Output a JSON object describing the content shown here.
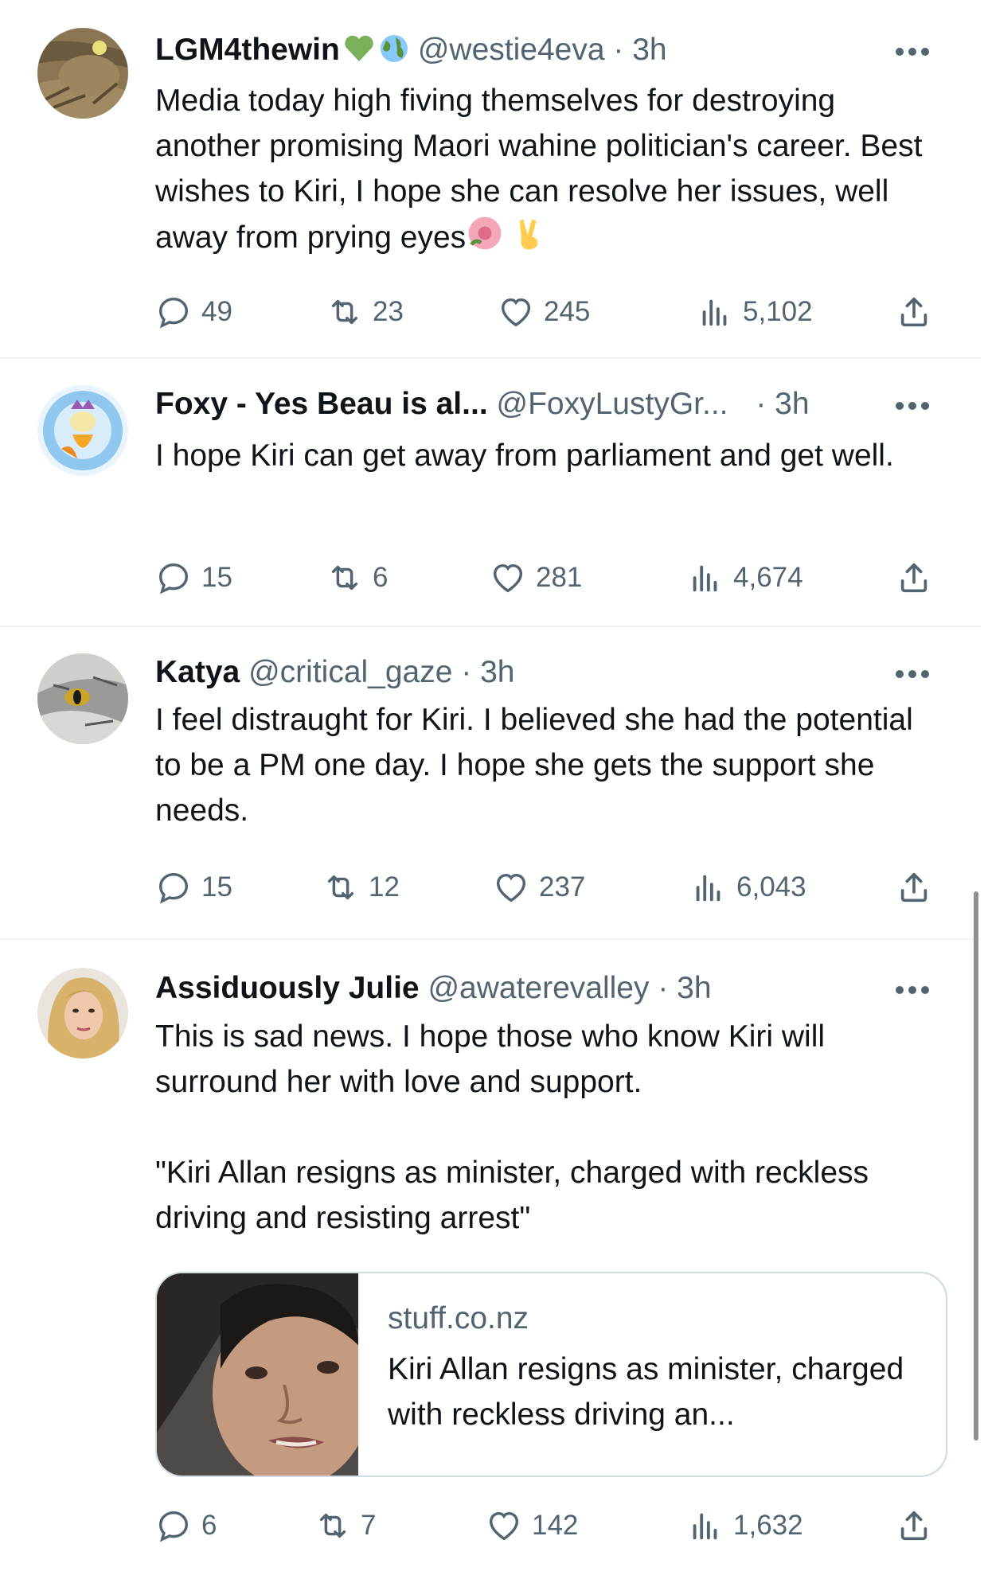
{
  "tweets": [
    {
      "name": "LGM4thewin",
      "handle": "@westie4eva",
      "time": "· 3h",
      "text": "Media today high fiving themselves for destroying another promising Maori wahine politician's career. Best wishes to Kiri, I hope she can resolve her issues, well away from prying eyes",
      "replies": "49",
      "retweets": "23",
      "likes": "245",
      "views": "5,102"
    },
    {
      "name": "Foxy - Yes Beau is al...",
      "handle": "@FoxyLustyGr...",
      "time": "· 3h",
      "text": "I hope Kiri can get away from parliament and get well.",
      "replies": "15",
      "retweets": "6",
      "likes": "281",
      "views": "4,674"
    },
    {
      "name": "Katya",
      "handle": "@critical_gaze",
      "time": "· 3h",
      "text": "I feel distraught for Kiri. I believed she had the potential to be a PM one day. I hope she gets the support she needs.",
      "replies": "15",
      "retweets": "12",
      "likes": "237",
      "views": "6,043"
    },
    {
      "name": "Assiduously Julie",
      "handle": "@awaterevalley",
      "time": "· 3h",
      "text": "This is sad news. I hope those who know Kiri will surround her with love and support.\n\n\"Kiri Allan resigns as minister, charged with reckless driving and resisting arrest\"",
      "card": {
        "domain": "stuff.co.nz",
        "title": "Kiri Allan resigns as minister, charged with reckless driving an..."
      },
      "replies": "6",
      "retweets": "7",
      "likes": "142",
      "views": "1,632"
    }
  ],
  "icons": {
    "reply": "reply-icon",
    "retweet": "retweet-icon",
    "like": "heart-icon",
    "views": "views-icon",
    "share": "share-icon",
    "more": "more-icon"
  },
  "colors": {
    "text": "#0f1419",
    "secondary": "#536471",
    "border": "#cfd9de",
    "heart_emoji": "#78b159"
  }
}
